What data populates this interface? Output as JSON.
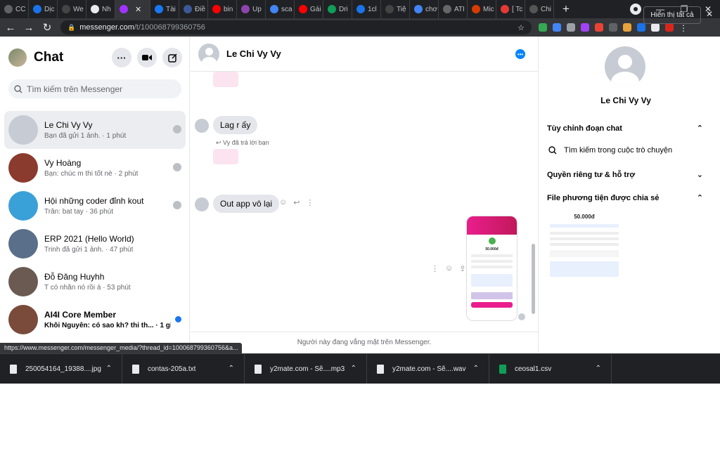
{
  "browser": {
    "tabs": [
      {
        "label": "CC",
        "color": "#5f6368"
      },
      {
        "label": "Dịc",
        "color": "#1a73e8"
      },
      {
        "label": "We",
        "color": "#444"
      },
      {
        "label": "Nh",
        "color": "#e8eaed"
      },
      {
        "label": "",
        "color": "#a033ff",
        "active": true
      },
      {
        "label": "Tài",
        "color": "#1877f2"
      },
      {
        "label": "Điề",
        "color": "#3b5998"
      },
      {
        "label": "bin",
        "color": "#ff0000"
      },
      {
        "label": "Up",
        "color": "#8e44ad"
      },
      {
        "label": "sca",
        "color": "#4285f4"
      },
      {
        "label": "Gái",
        "color": "#ff0000"
      },
      {
        "label": "Dri",
        "color": "#0f9d58"
      },
      {
        "label": "1cl",
        "color": "#1a73e8"
      },
      {
        "label": "Tiệ",
        "color": "#444"
      },
      {
        "label": "chơ",
        "color": "#4285f4"
      },
      {
        "label": "ATI",
        "color": "#666"
      },
      {
        "label": "Mic",
        "color": "#d83b01"
      },
      {
        "label": "[ Tc",
        "color": "#e53935"
      },
      {
        "label": "Chi",
        "color": "#555"
      }
    ],
    "url_prefix": "messenger.com",
    "url_path": "/t/100068799360756",
    "status_url": "https://www.messenger.com/messenger_media/?thread_id=100068799360756&a..."
  },
  "left": {
    "title": "Chat",
    "search_placeholder": "Tìm kiếm trên Messenger",
    "conversations": [
      {
        "name": "Le Chi Vy Vy",
        "sub": "Bạn đã gửi 1 ảnh. · 1 phút",
        "color": "#c7ccd4",
        "status": "#bcc0c4"
      },
      {
        "name": "Vy Hoàng",
        "sub": "Bạn: chúc m thi tốt nè · 2 phút",
        "color": "#8b3a2e",
        "status": "#bcc0c4"
      },
      {
        "name": "Hội những coder đỉnh kout",
        "sub": "Trân: bat tay · 36 phút",
        "color": "#3aa0d8",
        "status": "#bcc0c4"
      },
      {
        "name": "ERP 2021 (Hello World)",
        "sub": "Trinh đã gửi 1 ảnh. · 47 phút",
        "color": "#5a6f8a",
        "status": ""
      },
      {
        "name": "Đỗ Đăng Huyhh",
        "sub": "T có nhắn nó rồi á · 53 phút",
        "color": "#6b5a52",
        "status": ""
      },
      {
        "name": "AI4I Core Member",
        "sub": "Khôi Nguyên: có sao kh? thi th... · 1 giờ",
        "color": "#7a4a3a",
        "status": "#1877f2"
      }
    ]
  },
  "chat": {
    "name": "Le Chi Vy Vy",
    "msg1": "Lag r ấy",
    "reply_note": "Vy đã trả lời bạn",
    "msg2": "Out app vô lại",
    "footer": "Người này đang vắng mặt trên Messenger."
  },
  "right": {
    "name": "Le Chi Vy Vy",
    "sec1": "Tùy chỉnh đoạn chat",
    "search_item": "Tìm kiếm trong cuộc trò chuyện",
    "sec2": "Quyền riêng tư & hỗ trợ",
    "sec3": "File phương tiện được chia sẻ",
    "media_amount": "50.000đ"
  },
  "downloads": [
    {
      "name": "250054164_19388....jpg",
      "color": "#e8eaed"
    },
    {
      "name": "contas-205a.txt",
      "color": "#e8eaed"
    },
    {
      "name": "y2mate.com - Sẽ....mp3",
      "color": "#e8eaed"
    },
    {
      "name": "y2mate.com - Sẽ....wav",
      "color": "#e8eaed"
    },
    {
      "name": "ceosal1.csv",
      "color": "#0f9d58"
    }
  ],
  "downloads_show_all": "Hiển thị tất cả"
}
